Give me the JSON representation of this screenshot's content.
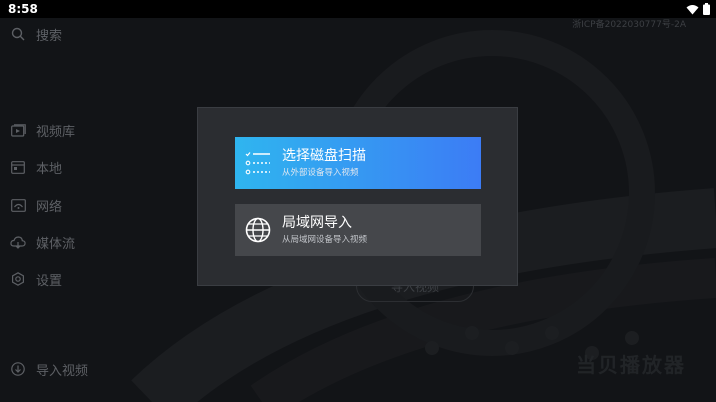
{
  "status_bar": {
    "time": "8:58"
  },
  "icp": "浙ICP备2022030777号-2A",
  "sidebar": {
    "search": "搜索",
    "items": [
      {
        "label": "视频库",
        "icon": "video-library-icon"
      },
      {
        "label": "本地",
        "icon": "folder-icon"
      },
      {
        "label": "网络",
        "icon": "network-icon"
      },
      {
        "label": "媒体流",
        "icon": "cloud-stream-icon"
      },
      {
        "label": "设置",
        "icon": "gear-icon"
      }
    ],
    "import": "导入视频"
  },
  "background": {
    "import_button": "导入视频",
    "watermark": "当贝播放器"
  },
  "dialog": {
    "options": [
      {
        "title": "选择磁盘扫描",
        "subtitle": "从外部设备导入视频",
        "icon": "checklist-icon",
        "selected": true
      },
      {
        "title": "局域网导入",
        "subtitle": "从局域网设备导入视频",
        "icon": "globe-icon",
        "selected": false
      }
    ]
  },
  "colors": {
    "accent_start": "#2fb5ef",
    "accent_end": "#3c7cf5",
    "dialog_bg": "#2b2d31"
  }
}
